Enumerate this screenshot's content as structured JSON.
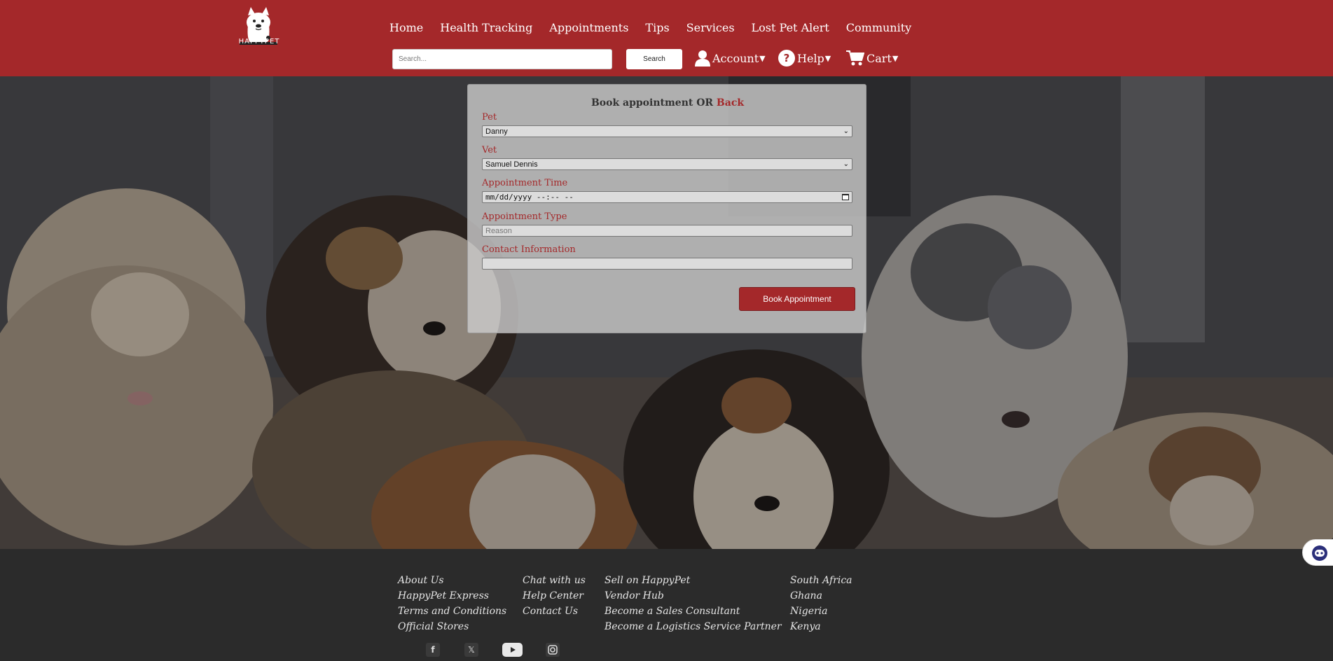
{
  "header": {
    "logo_text": "HAPPYPET",
    "nav": [
      "Home",
      "Health Tracking",
      "Appointments",
      "Tips",
      "Services",
      "Lost Pet Alert",
      "Community"
    ],
    "search_placeholder": "Search...",
    "search_button": "Search",
    "account": "Account",
    "help": "Help",
    "cart": "Cart",
    "brand_color": "#a4282a"
  },
  "form": {
    "title": "Book appointment OR ",
    "back": "Back",
    "pet_label": "Pet",
    "pet_value": "Danny",
    "vet_label": "Vet",
    "vet_value": "Samuel Dennis",
    "time_label": "Appointment Time",
    "time_placeholder": "mm/dd/yyyy --:-- --",
    "type_label": "Appointment Type",
    "type_placeholder": "Reason",
    "contact_label": "Contact Information",
    "contact_value": "",
    "submit": "Book Appointment"
  },
  "footer": {
    "col1": [
      "About Us",
      "HappyPet Express",
      "Terms and Conditions",
      "Official Stores"
    ],
    "col2": [
      "Chat with us",
      "Help Center",
      "Contact Us"
    ],
    "col3": [
      "Sell on HappyPet",
      "Vendor Hub",
      "Become a Sales Consultant",
      "Become a Logistics Service Partner"
    ],
    "col4": [
      "South Africa",
      "Ghana",
      "Nigeria",
      "Kenya"
    ],
    "social_icons": [
      "facebook-icon",
      "x-icon",
      "youtube-icon",
      "instagram-icon"
    ]
  }
}
